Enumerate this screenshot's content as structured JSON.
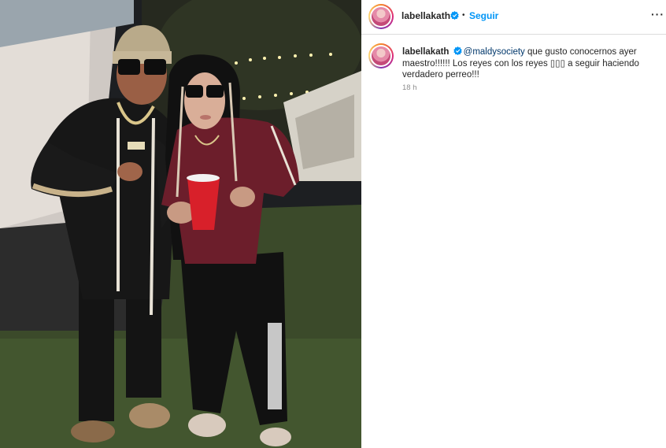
{
  "post": {
    "author": "labellakath",
    "follow_label": "Seguir",
    "separator": "•",
    "more_icon": "more-horizontal-icon",
    "verified_icon": "verified-badge-icon"
  },
  "caption": {
    "author": "labellakath",
    "mention": "@maldysociety",
    "text": " que gusto conocernos ayer maestro!!!!!! Los reyes con los reyes ▯▯▯ a seguir haciendo verdadero perreo!!!",
    "time": "18 h"
  },
  "colors": {
    "accent": "#0095f6",
    "verified": "#0095f6",
    "mention": "#00376b"
  }
}
